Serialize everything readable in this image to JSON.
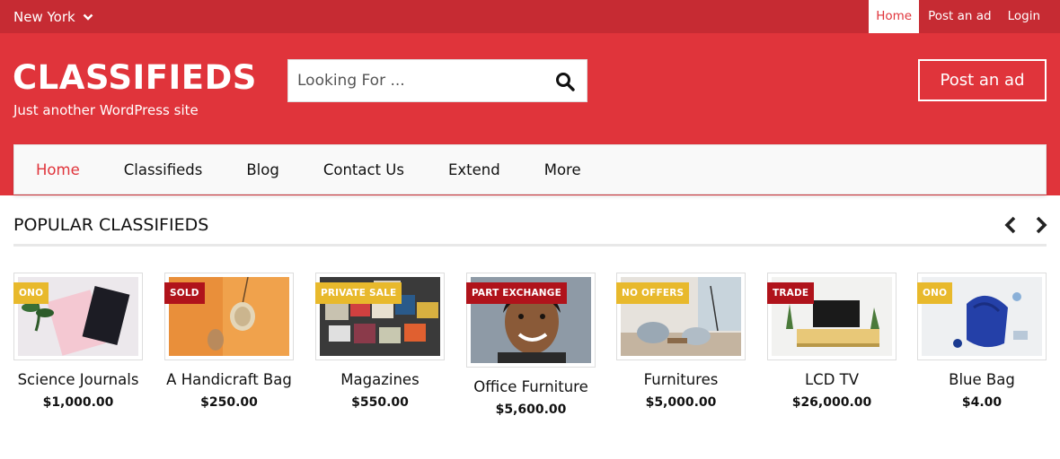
{
  "topbar": {
    "city": "New York",
    "links": [
      "Home",
      "Post an ad",
      "Login"
    ]
  },
  "header": {
    "logo": "CLASSIFIEDS",
    "tagline": "Just another WordPress site",
    "search_placeholder": "Looking For ...",
    "post_ad_label": "Post an ad"
  },
  "nav": {
    "items": [
      "Home",
      "Classifieds",
      "Blog",
      "Contact Us",
      "Extend",
      "More"
    ],
    "active": "Home"
  },
  "popular": {
    "title": "POPULAR CLASSIFIEDS",
    "items": [
      {
        "title": "Science Journals",
        "price": "$1,000.00",
        "badge": "ONO",
        "badge_color": "#e8b92c"
      },
      {
        "title": "A Handicraft Bag",
        "price": "$250.00",
        "badge": "SOLD",
        "badge_color": "#b0131b"
      },
      {
        "title": "Magazines",
        "price": "$550.00",
        "badge": "PRIVATE SALE",
        "badge_color": "#e8b92c"
      },
      {
        "title": "Office Furniture",
        "price": "$5,600.00",
        "badge": "PART EXCHANGE",
        "badge_color": "#b0131b"
      },
      {
        "title": "Furnitures",
        "price": "$5,000.00",
        "badge": "NO OFFERS",
        "badge_color": "#e8b92c"
      },
      {
        "title": "LCD TV",
        "price": "$26,000.00",
        "badge": "TRADE",
        "badge_color": "#b0131b"
      },
      {
        "title": "Blue Bag",
        "price": "$4.00",
        "badge": "ONO",
        "badge_color": "#e8b92c"
      }
    ]
  },
  "colors": {
    "topbar": "#c62b33",
    "brand": "#e0343b",
    "badge_yellow": "#e8b92c",
    "badge_red": "#b0131b"
  }
}
